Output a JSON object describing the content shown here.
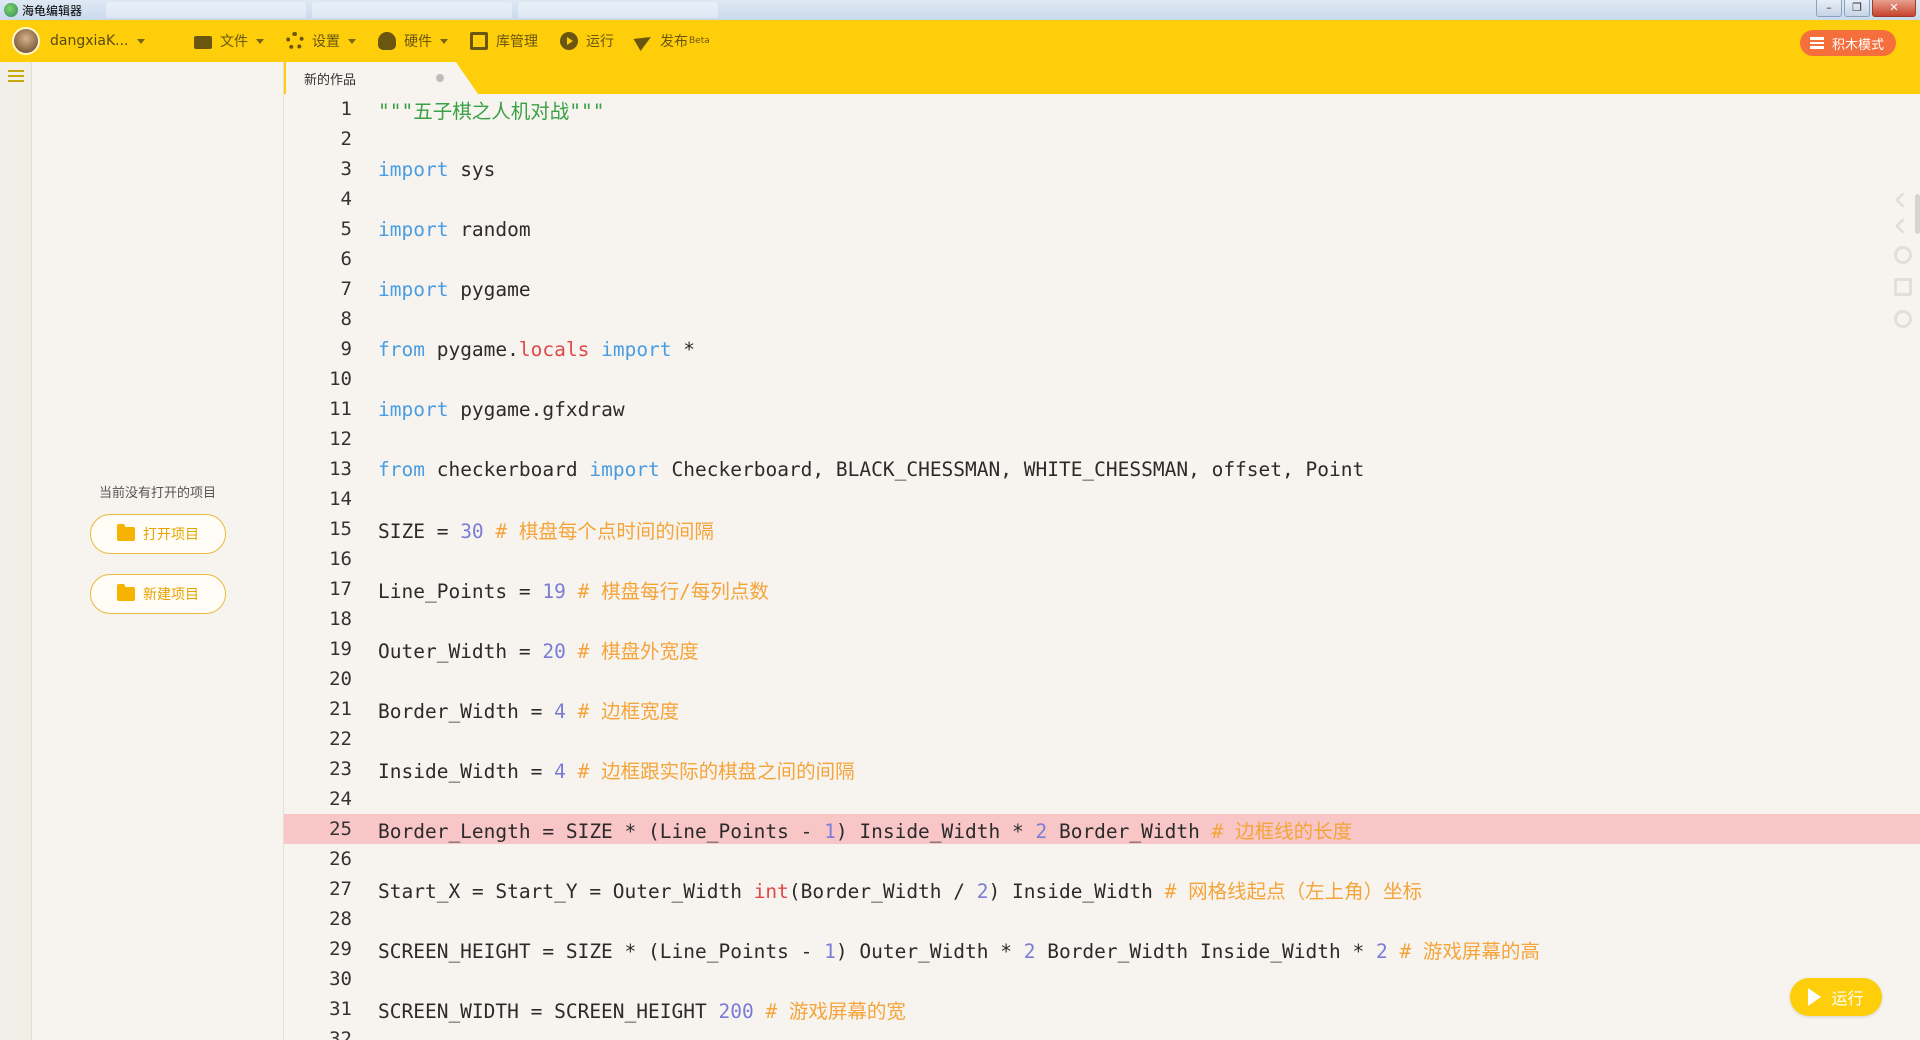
{
  "window": {
    "title": "海龟编辑器",
    "controls": [
      "–",
      "❐",
      "✕"
    ]
  },
  "toolbar": {
    "username": "dangxiaK...",
    "file": "文件",
    "settings": "设置",
    "hardware": "硬件",
    "library": "库管理",
    "run": "运行",
    "publish": "发布",
    "publish_badge": "Beta",
    "block_mode": "积木模式"
  },
  "project_panel": {
    "empty_text": "当前没有打开的项目",
    "open_label": "打开项目",
    "new_label": "新建项目"
  },
  "editor": {
    "tab_title": "新的作品",
    "highlighted_line": 25,
    "run_button": "运行",
    "lines": [
      [
        [
          "str",
          "\"\"\"五子棋之人机对战\"\"\""
        ]
      ],
      [],
      [
        [
          "kw",
          "import"
        ],
        [
          "op",
          " sys"
        ]
      ],
      [],
      [
        [
          "kw",
          "import"
        ],
        [
          "op",
          " random"
        ]
      ],
      [],
      [
        [
          "kw",
          "import"
        ],
        [
          "op",
          " pygame"
        ]
      ],
      [],
      [
        [
          "kw",
          "from"
        ],
        [
          "op",
          " pygame."
        ],
        [
          "bi",
          "locals"
        ],
        [
          "op",
          " "
        ],
        [
          "kw",
          "import"
        ],
        [
          "op",
          " *"
        ]
      ],
      [],
      [
        [
          "kw",
          "import"
        ],
        [
          "op",
          " pygame.gfxdraw"
        ]
      ],
      [],
      [
        [
          "kw",
          "from"
        ],
        [
          "op",
          " checkerboard "
        ],
        [
          "kw",
          "import"
        ],
        [
          "op",
          " Checkerboard, BLACK_CHESSMAN, WHITE_CHESSMAN, offset, Point"
        ]
      ],
      [],
      [
        [
          "op",
          "SIZE = "
        ],
        [
          "num",
          "30"
        ],
        [
          "op",
          " "
        ],
        [
          "cm",
          "# 棋盘每个点时间的间隔"
        ]
      ],
      [],
      [
        [
          "op",
          "Line_Points = "
        ],
        [
          "num",
          "19"
        ],
        [
          "op",
          " "
        ],
        [
          "cm",
          "# 棋盘每行/每列点数"
        ]
      ],
      [],
      [
        [
          "op",
          "Outer_Width = "
        ],
        [
          "num",
          "20"
        ],
        [
          "op",
          " "
        ],
        [
          "cm",
          "# 棋盘外宽度"
        ]
      ],
      [],
      [
        [
          "op",
          "Border_Width = "
        ],
        [
          "num",
          "4"
        ],
        [
          "op",
          " "
        ],
        [
          "cm",
          "# 边框宽度"
        ]
      ],
      [],
      [
        [
          "op",
          "Inside_Width = "
        ],
        [
          "num",
          "4"
        ],
        [
          "op",
          " "
        ],
        [
          "cm",
          "# 边框跟实际的棋盘之间的间隔"
        ]
      ],
      [],
      [
        [
          "op",
          "Border_Length = SIZE * (Line_Points - "
        ],
        [
          "num",
          "1"
        ],
        [
          "op",
          ") Inside_Width * "
        ],
        [
          "num",
          "2"
        ],
        [
          "op",
          " Border_Width "
        ],
        [
          "cm",
          "# 边框线的长度"
        ]
      ],
      [],
      [
        [
          "op",
          "Start_X = Start_Y = Outer_Width "
        ],
        [
          "bi",
          "int"
        ],
        [
          "op",
          "(Border_Width / "
        ],
        [
          "num",
          "2"
        ],
        [
          "op",
          ") Inside_Width "
        ],
        [
          "cm",
          "# 网格线起点（左上角）坐标"
        ]
      ],
      [],
      [
        [
          "op",
          "SCREEN_HEIGHT = SIZE * (Line_Points - "
        ],
        [
          "num",
          "1"
        ],
        [
          "op",
          ") Outer_Width * "
        ],
        [
          "num",
          "2"
        ],
        [
          "op",
          " Border_Width Inside_Width * "
        ],
        [
          "num",
          "2"
        ],
        [
          "op",
          " "
        ],
        [
          "cm",
          "# 游戏屏幕的高"
        ]
      ],
      [],
      [
        [
          "op",
          "SCREEN_WIDTH = SCREEN_HEIGHT "
        ],
        [
          "num",
          "200"
        ],
        [
          "op",
          " "
        ],
        [
          "cm",
          "# 游戏屏幕的宽"
        ]
      ],
      []
    ]
  }
}
